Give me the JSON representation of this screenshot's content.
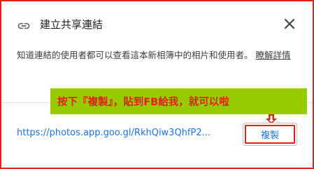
{
  "dialog": {
    "title": "建立共享連結",
    "description": "知道連結的使用者都可以查看這本新相簿中的相片和使用者。",
    "learn_more": "瞭解詳情",
    "link_url": "https://photos.app.goo.gl/RkhQiw3QhfP2...",
    "copy_label": "複製",
    "icons": {
      "link": "link-icon",
      "close": "close-icon"
    }
  },
  "annotation": {
    "callout_text": "按下『複製』，貼到FB給我，就可以啦",
    "callout_color": "#99cc00",
    "text_color": "#e0211b",
    "frame_color": "#e0211b",
    "arrow": "down-arrow-icon"
  },
  "colors": {
    "accent": "#1a73e8",
    "text": "#202124",
    "muted": "#3c4043"
  }
}
